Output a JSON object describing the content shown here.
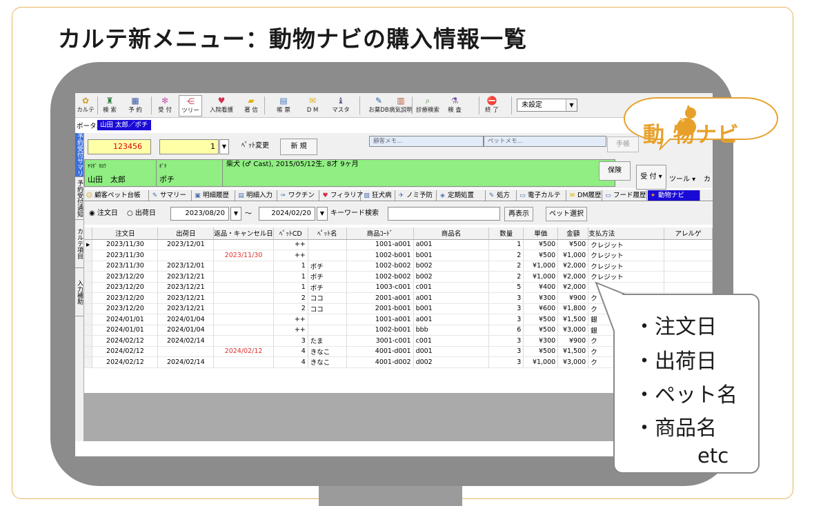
{
  "slide": {
    "title": "カルテ新メニュー：動物ナビの購入情報一覧",
    "logo_text": "動 物ナビ",
    "callout": [
      "・注文日",
      "・出荷日",
      "・ペット名",
      "・商品名",
      "etc"
    ]
  },
  "toolbar": {
    "buttons": [
      {
        "label": "カルテ",
        "icon": "karte-icon"
      },
      {
        "label": "検 索",
        "icon": "binoculars-icon"
      },
      {
        "label": "予 約",
        "icon": "calendar-icon"
      },
      {
        "label": "受 付",
        "icon": "reception-icon"
      },
      {
        "label": "ツリー",
        "icon": "tree-icon"
      },
      {
        "label": "入院看護",
        "icon": "heart-icon"
      },
      {
        "label": "著 信",
        "icon": "folder-icon"
      },
      {
        "label": "帳 票",
        "icon": "form-icon"
      },
      {
        "label": "D M",
        "icon": "mail-icon"
      },
      {
        "label": "マスタ",
        "icon": "master-icon"
      },
      {
        "label": "お薬DB",
        "icon": "medicine-icon"
      },
      {
        "label": "病気説明",
        "icon": "book-icon"
      },
      {
        "label": "診療検索",
        "icon": "magnifier-icon"
      },
      {
        "label": "検 査",
        "icon": "test-icon"
      },
      {
        "label": "終 了",
        "icon": "stop-icon"
      }
    ],
    "combo_value": "未設定"
  },
  "portal": {
    "label": "ポータル",
    "tab": "山田 太郎／ポチ"
  },
  "vtabs": [
    "予約受付サマリー",
    "予約受付通知",
    "カルテ項目",
    "入力補助"
  ],
  "patient": {
    "id": "123456",
    "pet_no": "1",
    "pet_change": "ﾍﾟｯﾄ変更",
    "new": "新 規",
    "customer_memo": "顧客メモ...",
    "pet_memo": "ペットメモ...",
    "notebook": "手帳",
    "owner_kana": "ﾔﾏﾀﾞ ﾀﾛｳ",
    "owner_name": "山田　太郎",
    "pet_kana": "ﾎﾟﾁ",
    "pet_name": "ポチ",
    "pet_info": "柴犬 (♂ Cast), 2015/05/12生, 8才 9ヶ月",
    "insurance": "保険",
    "reception": "受 付",
    "tool": "ツール",
    "extra": "カ"
  },
  "module_tabs": [
    {
      "label": "顧客ペット台帳",
      "icon": "smile-icon"
    },
    {
      "label": "サマリー",
      "icon": "summary-icon"
    },
    {
      "label": "明細履歴",
      "icon": "detail-history-icon"
    },
    {
      "label": "明細入力",
      "icon": "detail-input-icon"
    },
    {
      "label": "ワクチン",
      "icon": "syringe-icon"
    },
    {
      "label": "フィラリア",
      "icon": "heart-icon"
    },
    {
      "label": "狂犬病",
      "icon": "rabies-icon"
    },
    {
      "label": "ノミ予防",
      "icon": "flea-icon"
    },
    {
      "label": "定期処置",
      "icon": "routine-icon"
    },
    {
      "label": "処方",
      "icon": "prescription-icon"
    },
    {
      "label": "電子カルテ",
      "icon": "monitor-icon"
    },
    {
      "label": "DM履歴",
      "icon": "mail-icon"
    },
    {
      "label": "フード履歴",
      "icon": "food-icon"
    },
    {
      "label": "動物ナビ",
      "icon": "animal-navi-icon"
    }
  ],
  "filter": {
    "radio_order": "注文日",
    "radio_ship": "出荷日",
    "date_from": "2023/08/20",
    "tilde": "～",
    "date_to": "2024/02/20",
    "keyword_label": "キーワード検索",
    "keyword_value": "",
    "redisplay": "再表示",
    "pet_select": "ペット選択"
  },
  "table": {
    "headers": [
      "注文日",
      "出荷日",
      "返品・キャンセル日",
      "ﾍﾟｯﾄCD",
      "ﾍﾟｯﾄ名",
      "商品ｺｰﾄﾞ",
      "商品名",
      "数量",
      "単価",
      "金額",
      "支払方法",
      "アレルゲ"
    ],
    "rows": [
      {
        "order": "2023/11/30",
        "ship": "2023/12/01",
        "cancel": "",
        "pcd": "++",
        "pname": "",
        "code": "1001-a001",
        "item": "a001",
        "qty": "1",
        "price": "¥500",
        "amount": "¥500",
        "pay": "クレジット"
      },
      {
        "order": "2023/11/30",
        "ship": "",
        "cancel": "2023/11/30",
        "pcd": "++",
        "pname": "",
        "code": "1002-b001",
        "item": "b001",
        "qty": "2",
        "price": "¥500",
        "amount": "¥1,000",
        "pay": "クレジット"
      },
      {
        "order": "2023/11/30",
        "ship": "2023/12/01",
        "cancel": "",
        "pcd": "1",
        "pname": "ポチ",
        "code": "1002-b002",
        "item": "b002",
        "qty": "2",
        "price": "¥1,000",
        "amount": "¥2,000",
        "pay": "クレジット"
      },
      {
        "order": "2023/12/20",
        "ship": "2023/12/21",
        "cancel": "",
        "pcd": "1",
        "pname": "ポチ",
        "code": "1002-b002",
        "item": "b002",
        "qty": "2",
        "price": "¥1,000",
        "amount": "¥2,000",
        "pay": "クレジット"
      },
      {
        "order": "2023/12/20",
        "ship": "2023/12/21",
        "cancel": "",
        "pcd": "1",
        "pname": "ポチ",
        "code": "1003-c001",
        "item": "c001",
        "qty": "5",
        "price": "¥400",
        "amount": "¥2,000",
        "pay": ""
      },
      {
        "order": "2023/12/20",
        "ship": "2023/12/21",
        "cancel": "",
        "pcd": "2",
        "pname": "ココ",
        "code": "2001-a001",
        "item": "a001",
        "qty": "3",
        "price": "¥300",
        "amount": "¥900",
        "pay": "ク"
      },
      {
        "order": "2023/12/20",
        "ship": "2023/12/21",
        "cancel": "",
        "pcd": "2",
        "pname": "ココ",
        "code": "2001-b001",
        "item": "b001",
        "qty": "3",
        "price": "¥600",
        "amount": "¥1,800",
        "pay": "ク"
      },
      {
        "order": "2024/01/01",
        "ship": "2024/01/04",
        "cancel": "",
        "pcd": "++",
        "pname": "",
        "code": "1001-a001",
        "item": "a001",
        "qty": "3",
        "price": "¥500",
        "amount": "¥1,500",
        "pay": "銀"
      },
      {
        "order": "2024/01/01",
        "ship": "2024/01/04",
        "cancel": "",
        "pcd": "++",
        "pname": "",
        "code": "1002-b001",
        "item": "bbb",
        "qty": "6",
        "price": "¥500",
        "amount": "¥3,000",
        "pay": "銀"
      },
      {
        "order": "2024/02/12",
        "ship": "2024/02/14",
        "cancel": "",
        "pcd": "3",
        "pname": "たま",
        "code": "3001-c001",
        "item": "c001",
        "qty": "3",
        "price": "¥300",
        "amount": "¥900",
        "pay": "ク"
      },
      {
        "order": "2024/02/12",
        "ship": "",
        "cancel": "2024/02/12",
        "pcd": "4",
        "pname": "きなこ",
        "code": "4001-d001",
        "item": "d001",
        "qty": "3",
        "price": "¥500",
        "amount": "¥1,500",
        "pay": "ク"
      },
      {
        "order": "2024/02/12",
        "ship": "2024/02/14",
        "cancel": "",
        "pcd": "4",
        "pname": "きなこ",
        "code": "4001-d002",
        "item": "d002",
        "qty": "3",
        "price": "¥1,000",
        "amount": "¥3,000",
        "pay": "ク"
      }
    ]
  }
}
